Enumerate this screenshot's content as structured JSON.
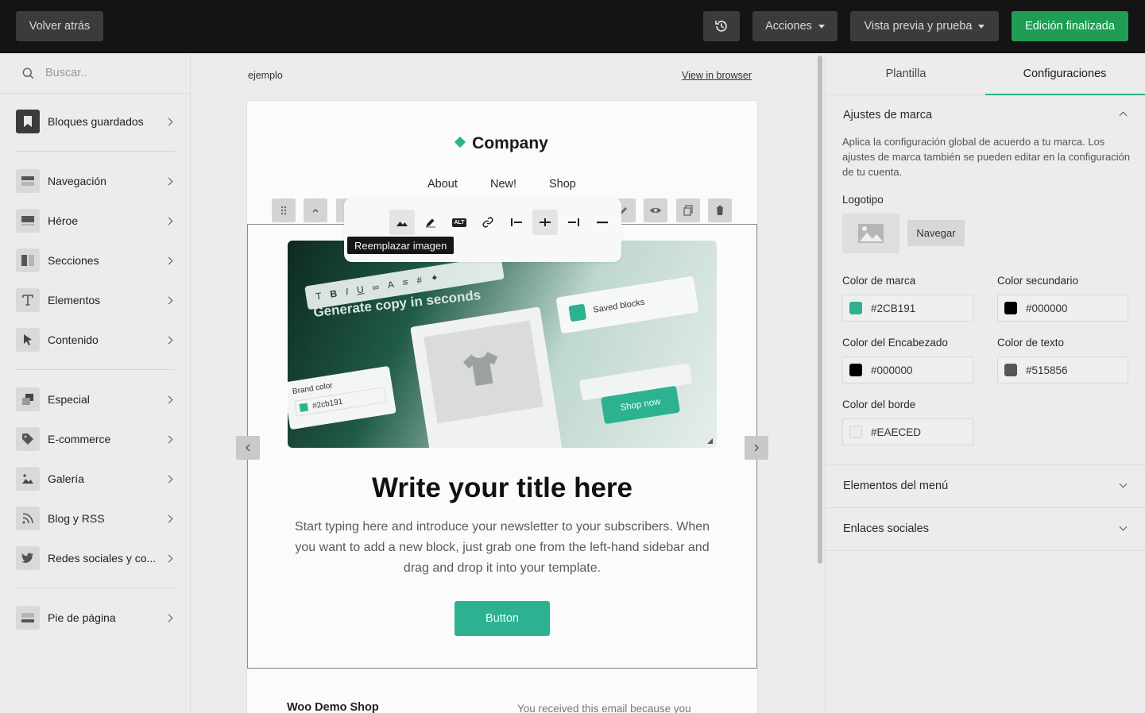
{
  "topbar": {
    "back_label": "Volver atrás",
    "actions_label": "Acciones",
    "preview_label": "Vista previa y prueba",
    "done_label": "Edición finalizada"
  },
  "sidebar": {
    "search_placeholder": "Buscar..",
    "items": [
      {
        "label": "Bloques guardados",
        "icon": "bookmark-icon"
      },
      {
        "label": "Navegación",
        "icon": "navigation-block-icon"
      },
      {
        "label": "Héroe",
        "icon": "hero-block-icon"
      },
      {
        "label": "Secciones",
        "icon": "columns-icon"
      },
      {
        "label": "Elementos",
        "icon": "text-t-icon"
      },
      {
        "label": "Contenido",
        "icon": "cursor-arrow-icon"
      },
      {
        "label": "Especial",
        "icon": "stack-icon"
      },
      {
        "label": "E-commerce",
        "icon": "tag-icon"
      },
      {
        "label": "Galería",
        "icon": "image-icon"
      },
      {
        "label": "Blog y RSS",
        "icon": "rss-icon"
      },
      {
        "label": "Redes sociales y co...",
        "icon": "twitter-bird-icon"
      },
      {
        "label": "Pie de página",
        "icon": "footer-block-icon"
      }
    ]
  },
  "canvas": {
    "preheader": "ejemplo",
    "view_in_browser": "View in browser",
    "brand_name": "Company",
    "menu": [
      "About",
      "New!",
      "Shop"
    ],
    "tooltip": "Reemplazar imagen",
    "hero_title": "Write your title here",
    "hero_body": "Start typing here and introduce your newsletter to your subscribers. When you want to add a new block, just grab one from the left-hand sidebar and drag and drop it into your template.",
    "button_label": "Button",
    "footer_shop": "Woo Demo Shop",
    "footer_note": "You received this email because you",
    "hero_image": {
      "generate_copy": "Generate copy in seconds",
      "saved_blocks": "Saved blocks",
      "brand_color_label": "Brand color",
      "brand_color_value": "#2cb191",
      "shop_now": "Shop now",
      "alt_badge": "ALT"
    }
  },
  "rpanel": {
    "tabs": [
      "Plantilla",
      "Configuraciones"
    ],
    "brand_section": "Ajustes de marca",
    "brand_desc": "Aplica la configuración global de acuerdo a tu marca. Los ajustes de marca también se pueden editar en la configuración de tu cuenta.",
    "logo_label": "Logotipo",
    "browse_label": "Navegar",
    "colors": {
      "brand_label": "Color de marca",
      "brand_value": "#2CB191",
      "secondary_label": "Color secundario",
      "secondary_value": "#000000",
      "heading_label": "Color del Encabezado",
      "heading_value": "#000000",
      "text_label": "Color de texto",
      "text_value": "#515856",
      "border_label": "Color del borde",
      "border_value": "#EAECED"
    },
    "menu_section": "Elementos del menú",
    "social_section": "Enlaces sociales"
  },
  "colors": {
    "accent": "#2cb191",
    "done_button": "#1f9d55",
    "topbar": "#141414"
  }
}
